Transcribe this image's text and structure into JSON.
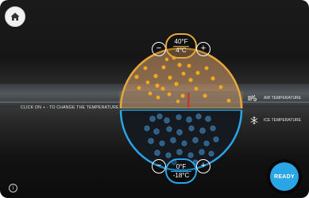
{
  "instruction": "CLICK ON + - TO CHANGE THE TEMPERATURE",
  "air": {
    "temp_f": "40°F",
    "temp_c": "4°C",
    "legend_label": "AIR TEMPERATURE",
    "minus": "−",
    "plus": "+"
  },
  "ice": {
    "temp_f": "0°F",
    "temp_c": "-18°C",
    "legend_label": "ICE TEMPERATURE",
    "minus": "−",
    "plus": "+"
  },
  "ready_label": "READY",
  "info_glyph": "i",
  "colors": {
    "air_accent": "#e7a73a",
    "ice_accent": "#2aa6e6",
    "air_particle": "#f3a81d",
    "ice_particle": "#2e5f86"
  },
  "icons": [
    "home-icon",
    "air-temperature-icon",
    "snowflake-icon",
    "info-icon"
  ]
}
